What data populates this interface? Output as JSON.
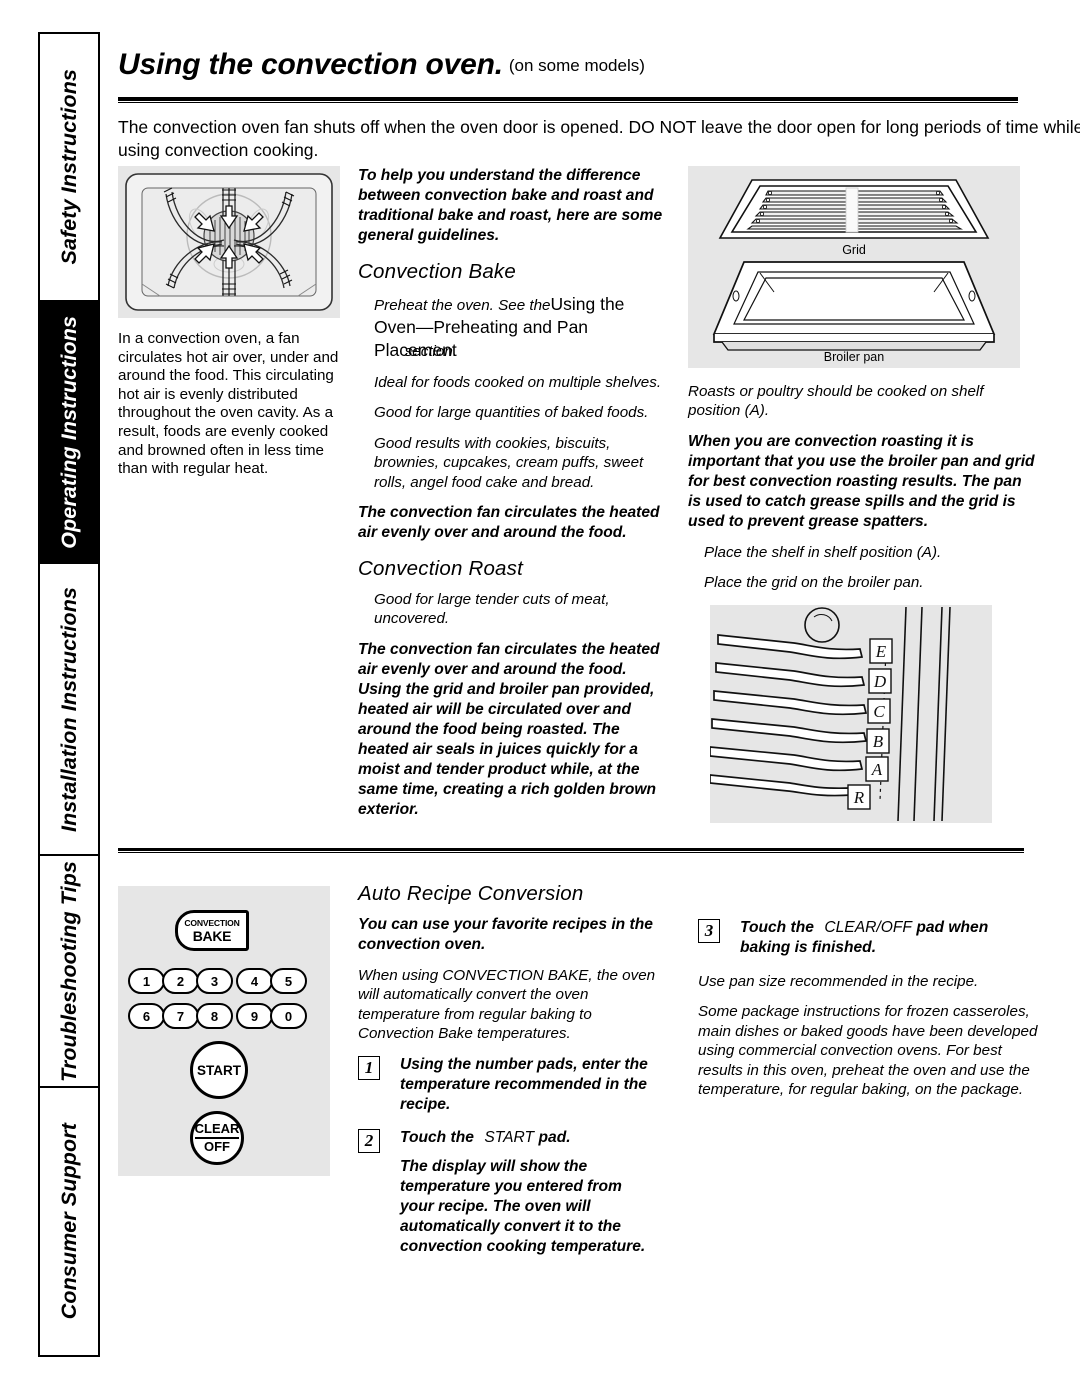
{
  "sidebar": {
    "tabs": [
      {
        "label": "Safety Instructions",
        "active": false
      },
      {
        "label": "Operating Instructions",
        "active": true
      },
      {
        "label": "Installation Instructions",
        "active": false
      },
      {
        "label": "Troubleshooting Tips",
        "active": false
      },
      {
        "label": "Consumer Support",
        "active": false
      }
    ]
  },
  "header": {
    "title": "Using the convection oven.",
    "subtitle": "(on some models)",
    "intro": "The convection oven fan shuts off when the oven door is opened. DO NOT leave the door open for long periods of time while using convection cooking."
  },
  "left_column": {
    "figure_name": "convection-oven-airflow",
    "paragraph": "In a convection oven, a fan circulates hot air over, under and around the food. This circulating hot air is evenly distributed throughout the oven cavity. As a result, foods are evenly cooked and browned often in less time than with regular heat."
  },
  "middle_column": {
    "lead_bold": "To help you understand the difference between convection bake and roast and traditional bake and roast, here are some general guidelines.",
    "bake_heading": "Convection Bake",
    "bake_preheat_italic": "Preheat the oven. See the",
    "bake_preheat_reference": "Using the Oven—Preheating and Pan Placement",
    "bake_preheat_tail": "section.",
    "bake_bullets": [
      "Ideal for foods cooked on multiple shelves.",
      "Good for large quantities of baked foods.",
      "Good results with cookies, biscuits, brownies, cupcakes, cream puffs, sweet rolls, angel food cake and bread."
    ],
    "bake_bold_note": "The convection fan circulates the heated air evenly over and around the food.",
    "roast_heading": "Convection Roast",
    "roast_bullets": [
      "Good for large tender cuts of meat, uncovered."
    ],
    "roast_bold_note": "The convection fan circulates the heated air evenly over and around the food. Using the grid and broiler pan provided, heated air will be circulated over and around the food being roasted. The heated air seals in juices quickly for a moist and tender product while, at the same time, creating a rich golden brown exterior."
  },
  "right_column": {
    "grid_caption": "Grid",
    "broiler_caption": "Broiler pan",
    "shelf_note": "Roasts or poultry should be cooked on shelf position (A).",
    "bold_note": "When you are convection roasting it is important that you use the broiler pan and grid for best convection roasting results. The pan is used to catch grease spills and the grid is used to prevent grease spatters.",
    "steps_italic": [
      "Place the shelf in shelf position (A).",
      "Place the grid on the broiler pan."
    ],
    "shelf_labels": [
      "E",
      "D",
      "C",
      "B",
      "A",
      "R"
    ]
  },
  "control_panel": {
    "convection_bake_line1": "CONVECTION",
    "convection_bake_line2": "BAKE",
    "number_keys_row1": [
      "1",
      "2",
      "3",
      "4",
      "5"
    ],
    "number_keys_row2": [
      "6",
      "7",
      "8",
      "9",
      "0"
    ],
    "start_label": "START",
    "clear_label_line1": "CLEAR",
    "clear_label_line2": "OFF"
  },
  "auto_recipe": {
    "heading": "Auto Recipe  Conversion",
    "bold_lead": "You can use your favorite recipes in the convection oven.",
    "italic_intro": "When using CONVECTION BAKE, the oven will automatically convert the oven temperature from regular baking to Convection Bake temperatures.",
    "step1_num": "1",
    "step1_text": "Using the number pads, enter the temperature recommended in the recipe.",
    "step2_num": "2",
    "step2_prefix": "Touch the",
    "step2_pad": "START",
    "step2_suffix": "pad.",
    "step2_body": "The display will show the temperature you entered from your recipe. The oven will automatically convert it to the convection cooking temperature.",
    "step3_num": "3",
    "step3_prefix": "Touch the",
    "step3_pad": "CLEAR/OFF",
    "step3_suffix": "pad when",
    "step3_line2": "baking is finished.",
    "note1": "Use pan size recommended in the recipe.",
    "note2": "Some package instructions for frozen casseroles, main dishes or baked goods have been developed using commercial convection ovens. For best results in this oven, preheat the oven and use the temperature, for regular baking, on the package."
  }
}
